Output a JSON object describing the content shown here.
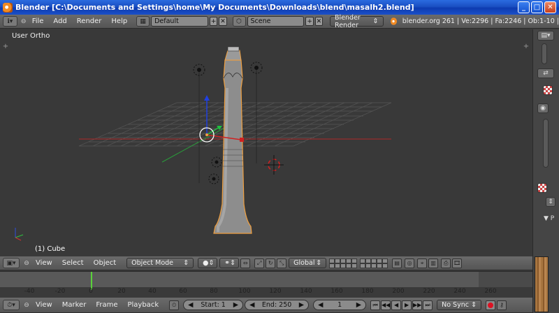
{
  "window": {
    "title": "Blender [C:\\Documents and Settings\\home\\My Documents\\Downloads\\blend\\masalh2.blend]",
    "minimize": "_",
    "maximize": "□",
    "close": "✕"
  },
  "info_header": {
    "menus": [
      "File",
      "Add",
      "Render",
      "Help"
    ],
    "screen_layout": "Default",
    "scene": "Scene",
    "render_engine": "Blender Render",
    "stats": "blender.org 261 | Ve:2296 | Fa:2246 | Ob:1-10 |"
  },
  "viewport": {
    "view_label": "User Ortho",
    "active_object_label": "(1) Cube"
  },
  "view3d_header": {
    "menus": [
      "View",
      "Select",
      "Object"
    ],
    "mode": "Object Mode",
    "transform_orientation": "Global"
  },
  "timeline": {
    "ticks": [
      "-40",
      "-20",
      "0",
      "20",
      "40",
      "60",
      "80",
      "100",
      "120",
      "140",
      "160",
      "180",
      "200",
      "220",
      "240",
      "260"
    ],
    "current_frame_value": 1
  },
  "timeline_header": {
    "menus": [
      "View",
      "Marker",
      "Frame",
      "Playback"
    ],
    "start": "Start: 1",
    "end": "End: 250",
    "current_frame": "1",
    "sync": "No Sync"
  },
  "right_panel": {
    "tab_label": "P"
  },
  "colors": {
    "title_bar": "#1a4fc2",
    "viewport_bg": "#393939",
    "selection_outline": "#f0a040",
    "x_axis": "#d02020",
    "y_axis": "#20c040",
    "z_axis": "#2040e0",
    "frame_cursor": "#5ad13a"
  },
  "icons": [
    "blender-logo-icon",
    "editor-type-icon",
    "screen-layout-icon",
    "scene-icon",
    "lamp-icon",
    "camera-icon",
    "pivot-icon",
    "manipulator-icon",
    "record-icon",
    "play-icon"
  ]
}
